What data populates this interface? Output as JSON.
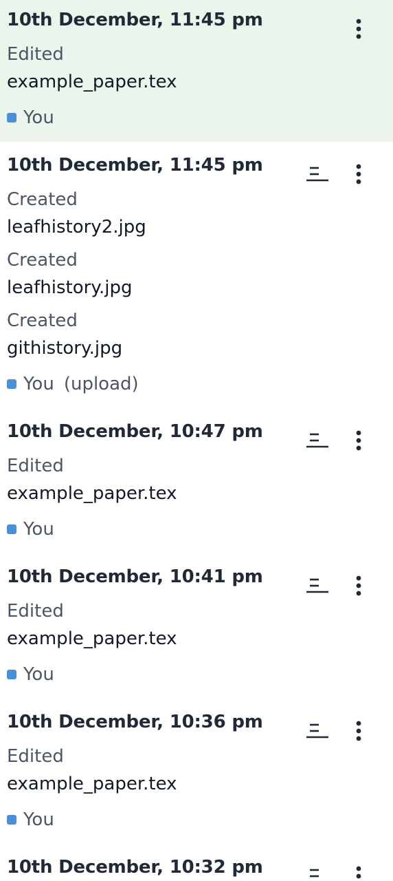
{
  "colors": {
    "selected_bg": "#ebf5ec",
    "user_swatch": "#4a90d9"
  },
  "icons": {
    "compare": "compare-versions-icon",
    "more": "more-vertical-icon"
  },
  "entries": [
    {
      "date": "10th December, 11:45 pm",
      "selected": true,
      "changes": [
        {
          "action": "Edited",
          "file": "example_paper.tex"
        }
      ],
      "user": "You",
      "origin": ""
    },
    {
      "date": "10th December, 11:45 pm",
      "selected": false,
      "changes": [
        {
          "action": "Created",
          "file": "leafhistory2.jpg"
        },
        {
          "action": "Created",
          "file": "leafhistory.jpg"
        },
        {
          "action": "Created",
          "file": "githistory.jpg"
        }
      ],
      "user": "You",
      "origin": "(upload)"
    },
    {
      "date": "10th December, 10:47 pm",
      "selected": false,
      "changes": [
        {
          "action": "Edited",
          "file": "example_paper.tex"
        }
      ],
      "user": "You",
      "origin": ""
    },
    {
      "date": "10th December, 10:41 pm",
      "selected": false,
      "changes": [
        {
          "action": "Edited",
          "file": "example_paper.tex"
        }
      ],
      "user": "You",
      "origin": ""
    },
    {
      "date": "10th December, 10:36 pm",
      "selected": false,
      "changes": [
        {
          "action": "Edited",
          "file": "example_paper.tex"
        }
      ],
      "user": "You",
      "origin": ""
    },
    {
      "date": "10th December, 10:32 pm",
      "selected": false,
      "changes": [],
      "user": "",
      "origin": ""
    }
  ]
}
